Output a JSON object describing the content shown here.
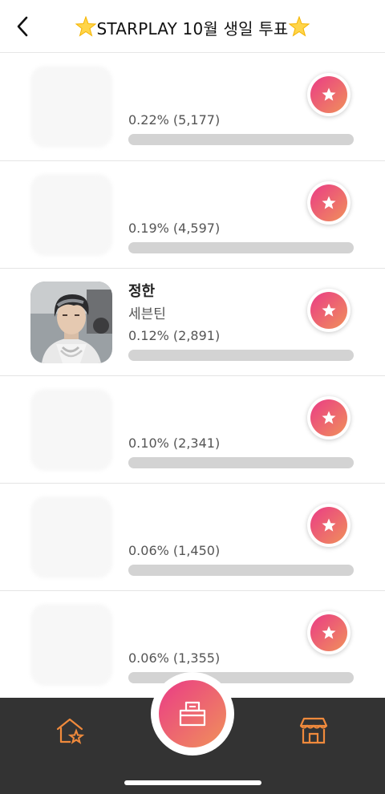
{
  "header": {
    "title": "STARPLAY 10월 생일 투표",
    "star_emoji": "🌟"
  },
  "list": [
    {
      "name": "",
      "group": "",
      "percent_text": "0.22% (5,177)",
      "share": 0.22,
      "blurred": true
    },
    {
      "name": "",
      "group": "",
      "percent_text": "0.19% (4,597)",
      "share": 0.19,
      "blurred": true
    },
    {
      "name": "정한",
      "group": "세븐틴",
      "percent_text": "0.12% (2,891)",
      "share": 0.12,
      "blurred": false
    },
    {
      "name": "",
      "group": "",
      "percent_text": "0.10% (2,341)",
      "share": 0.1,
      "blurred": true
    },
    {
      "name": "",
      "group": "",
      "percent_text": "0.06% (1,450)",
      "share": 0.06,
      "blurred": true
    },
    {
      "name": "",
      "group": "",
      "percent_text": "0.06% (1,355)",
      "share": 0.06,
      "blurred": true
    }
  ],
  "colors": {
    "accent_start": "#ea3b86",
    "accent_end": "#f0915a",
    "nav_bg": "#333333",
    "nav_icon": "#f08a3c",
    "bar_track": "#d3d3d3"
  },
  "icons": {
    "back": "chevron-left-icon",
    "vote": "star-icon",
    "center": "ballot-box-icon",
    "home": "home-star-icon",
    "shop": "store-icon"
  }
}
